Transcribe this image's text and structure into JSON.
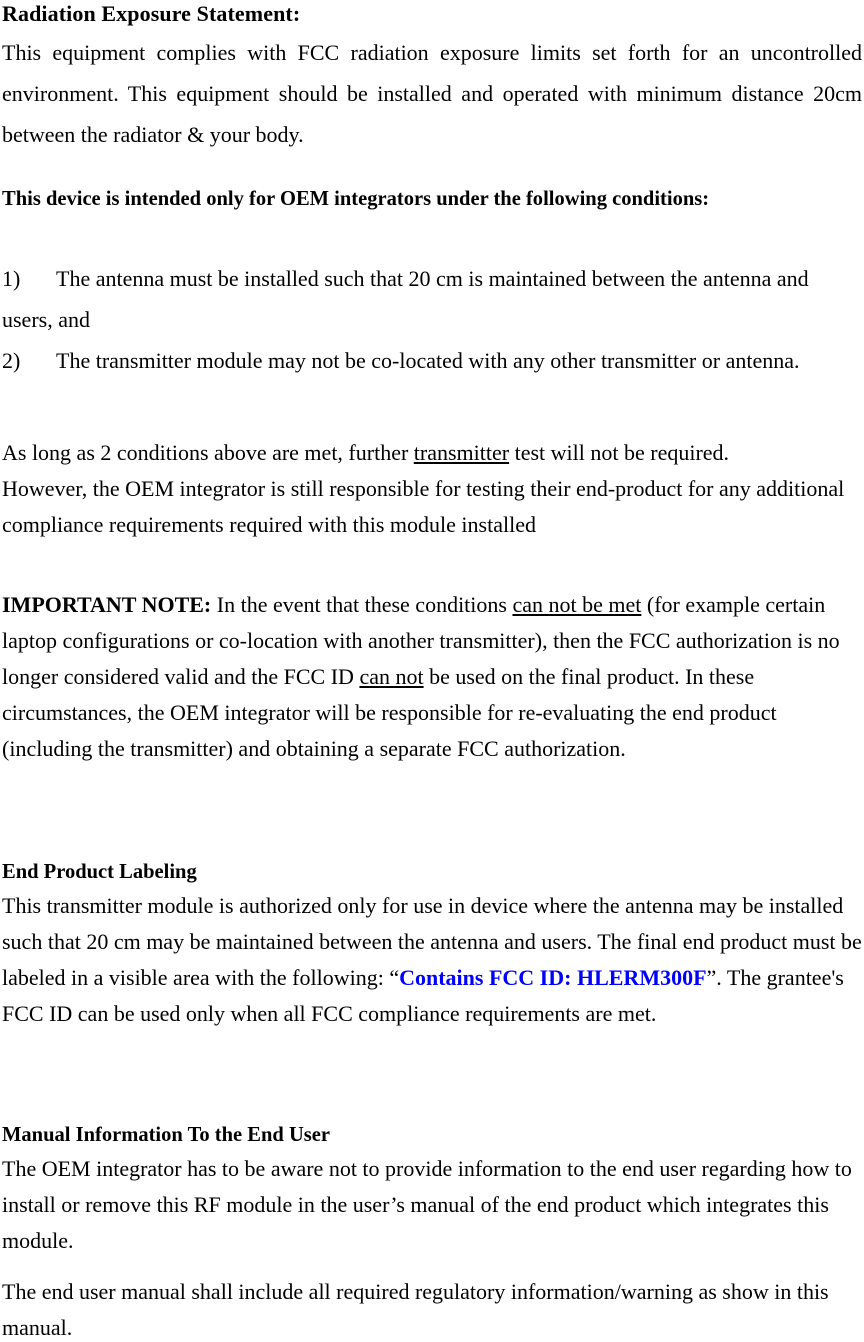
{
  "document": {
    "title": "Radiation Exposure Statement / FCC OEM Integrator Notice",
    "text_color": "#000000",
    "accent_color": "#0000ff",
    "background": "#ffffff"
  },
  "section_radiation": {
    "heading": "Radiation Exposure Statement:",
    "body": "This equipment complies with FCC radiation exposure limits set forth for an uncontrolled environment. This equipment should be installed and operated with minimum distance 20cm between the radiator & your body."
  },
  "section_oem": {
    "heading": "This device is intended only for OEM integrators under the following conditions:",
    "items": [
      {
        "number": "1)",
        "text": "The antenna must be installed such that 20 cm is maintained between the antenna and users, and"
      },
      {
        "number": "2)",
        "text": "The transmitter module may not be co-located with any other transmitter or antenna."
      }
    ]
  },
  "section_conditions": {
    "line1_before": "As long as 2 conditions above are met, further ",
    "line1_underlined": "transmitter",
    "line1_after": " test will not be required.",
    "line2": "However, the OEM integrator is still responsible for testing their end-product for any additional compliance requirements required with this module installed"
  },
  "section_important": {
    "label": "IMPORTANT NOTE:",
    "part1": " In the event that these conditions ",
    "underline1": "can not be met",
    "part2": " (for example certain laptop configurations or co-location with another transmitter), then the FCC authorization is no longer considered valid and the FCC ID ",
    "underline2": "can not",
    "part3": " be used on the final product. In these circumstances, the OEM integrator will be responsible for re-evaluating the end product (including the transmitter) and obtaining a separate FCC authorization."
  },
  "section_labeling": {
    "heading": "End Product Labeling",
    "part1": "This transmitter module is authorized only for use in device where the antenna may be installed such that 20 cm may be maintained between the antenna and users. The final end product must be labeled in a visible area with the following: “",
    "fcc_prefix": "Contains FCC ID:",
    "fcc_id": "HLERM300F",
    "part2": "”. The grantee's FCC ID can be used only when all FCC compliance requirements are met."
  },
  "section_manual": {
    "heading": "Manual Information To the End User",
    "paragraph1": "The OEM integrator has to be aware not to provide information to the end user regarding how to install or remove this RF module in the user’s manual of the end product which integrates this module.",
    "paragraph2": "The end user manual shall include all required regulatory information/warning as show in this manual."
  }
}
